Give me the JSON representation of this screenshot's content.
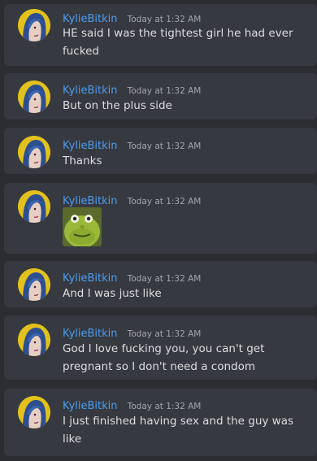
{
  "messages": [
    {
      "username": "KylieBitkin",
      "timestamp": "Today at 1:32 AM",
      "text": "HE said I was the tightest girl he had ever fucked"
    },
    {
      "username": "KylieBitkin",
      "timestamp": "Today at 1:32 AM",
      "text": "But on the plus side"
    },
    {
      "username": "KylieBitkin",
      "timestamp": "Today at 1:32 AM",
      "text": "Thanks"
    },
    {
      "username": "KylieBitkin",
      "timestamp": "Today at 1:32 AM",
      "text": "",
      "emote": "mike-wazowski-face-swap-emote"
    },
    {
      "username": "KylieBitkin",
      "timestamp": "Today at 1:32 AM",
      "text": "And I was just like"
    },
    {
      "username": "KylieBitkin",
      "timestamp": "Today at 1:32 AM",
      "text": "God I love fucking you, you can't get pregnant so I don't need a condom"
    },
    {
      "username": "KylieBitkin",
      "timestamp": "Today at 1:32 AM",
      "text": "I just finished having sex and the guy was like"
    }
  ],
  "colors": {
    "background": "#2b2d31",
    "message_background": "#36393f",
    "username": "#4d9cf0",
    "timestamp": "#a3a6aa",
    "text": "#dcddde",
    "avatar_ring": "#e2c11d"
  }
}
